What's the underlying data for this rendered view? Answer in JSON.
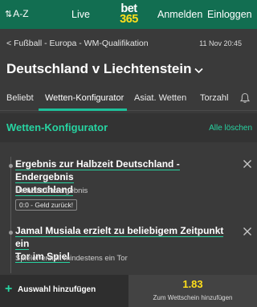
{
  "header": {
    "az_label": "A-Z",
    "live_label": "Live",
    "logo_top": "bet",
    "logo_bottom": "365",
    "login_label": "Anmelden",
    "register_label": "Einloggen"
  },
  "breadcrumb": {
    "text": "Fußball - Europa - WM-Qualifikation",
    "datetime": "11 Nov 20:45"
  },
  "match": {
    "title": "Deutschland v Liechtenstein"
  },
  "tabs": [
    {
      "label": "Beliebt"
    },
    {
      "label": "Wetten-Konfigurator"
    },
    {
      "label": "Asiat. Wetten"
    },
    {
      "label": "Torzahl"
    }
  ],
  "konfigurator": {
    "title": "Wetten-Konfigurator",
    "clear_all": "Alle löschen"
  },
  "selections": [
    {
      "title_line1": "Ergebnis zur Halbzeit Deutschland - Endergebnis",
      "title_line2": "Deutschland",
      "subtitle": "Halbzeit/Endergebnis",
      "badge": "0:0 - Geld zurück!"
    },
    {
      "title_line1": "Jamal Musiala erzielt zu beliebigem Zeitpunkt ein",
      "title_line2": "Tor im Spiel",
      "subtitle": "Spieler erzielt mindestens ein Tor"
    }
  ],
  "bottom": {
    "add_label": "Auswahl hinzufügen",
    "odds": "1.83",
    "slip_label": "Zum Wettschein hinzufügen"
  },
  "colors": {
    "header_green": "#126e51",
    "accent_teal": "#27d3a1",
    "odds_yellow": "#ffdf1b",
    "background": "#3a3a3a"
  }
}
